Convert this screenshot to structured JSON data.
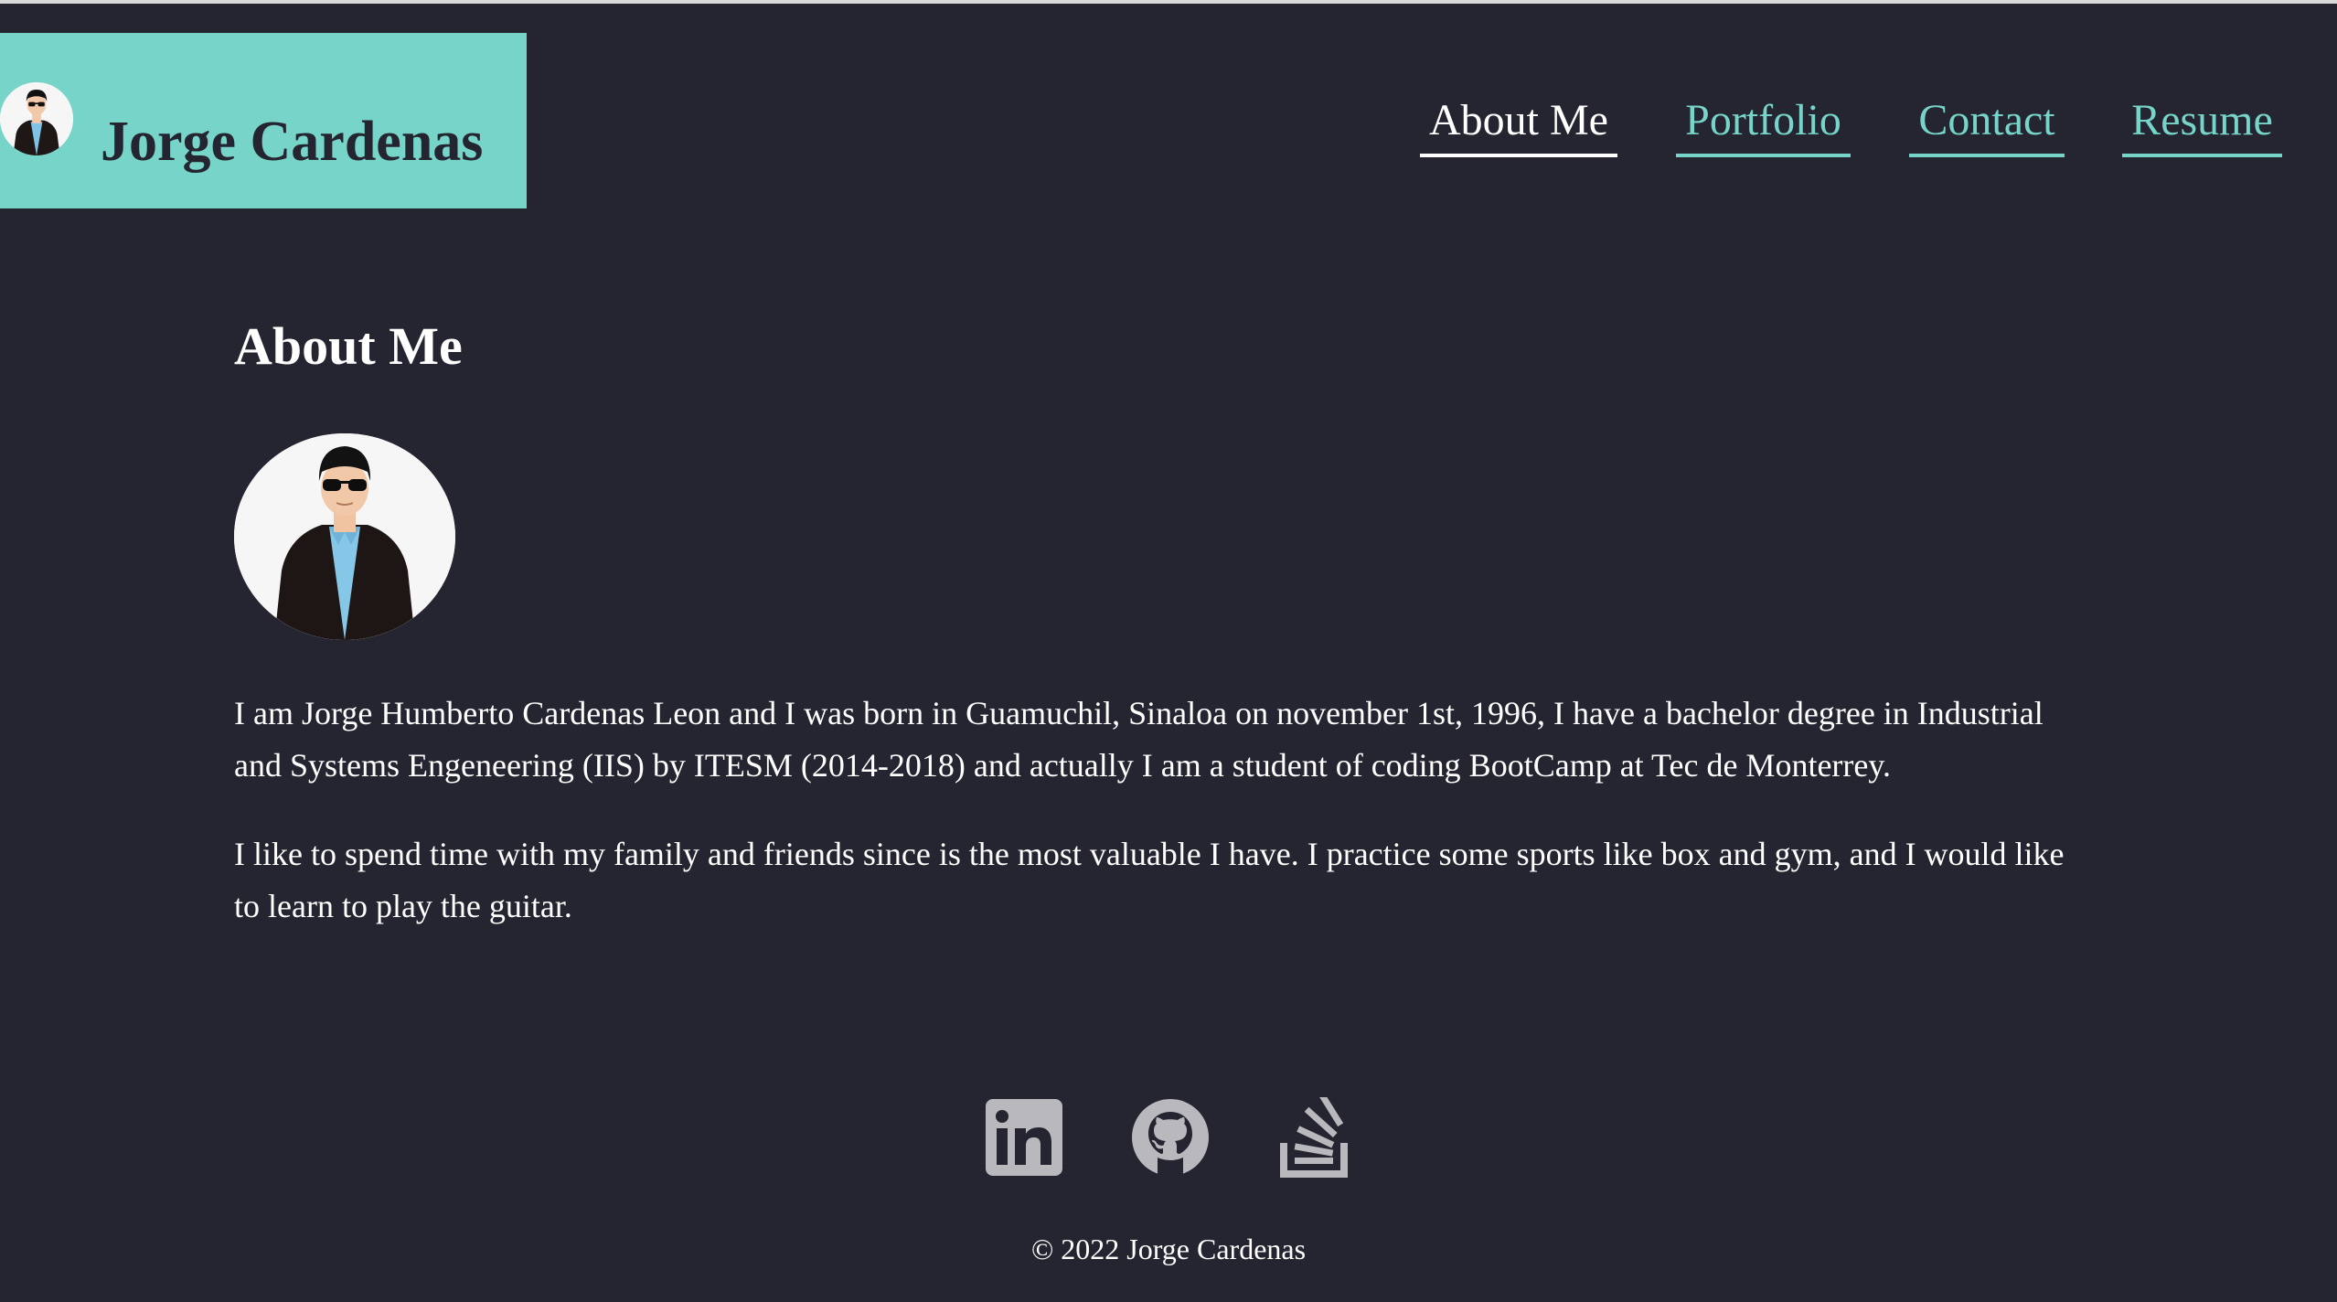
{
  "header": {
    "brand_name": "Jorge Cardenas",
    "brand_color": "#77d4c8",
    "nav": [
      {
        "label": "About Me",
        "active": true
      },
      {
        "label": "Portfolio",
        "active": false
      },
      {
        "label": "Contact",
        "active": false
      },
      {
        "label": "Resume",
        "active": false
      }
    ]
  },
  "main": {
    "section_title": "About Me",
    "paragraphs": [
      "I am Jorge Humberto Cardenas Leon and I was born in Guamuchil, Sinaloa on november 1st, 1996, I have a bachelor degree in Industrial and Systems Engeneering (IIS) by ITESM (2014-2018) and actually I am a student of coding BootCamp at Tec de Monterrey.",
      "I like to spend time with my family and friends since is the most valuable I have. I practice some sports like box and gym, and I would like to learn to play the guitar."
    ]
  },
  "social": [
    {
      "icon": "linkedin-icon"
    },
    {
      "icon": "github-icon"
    },
    {
      "icon": "stackoverflow-icon"
    }
  ],
  "footer": {
    "copyright": "© 2022 Jorge Cardenas"
  },
  "colors": {
    "background": "#242530",
    "accent": "#77d4c8",
    "icon": "#b9b9bd",
    "text": "#ffffff"
  }
}
